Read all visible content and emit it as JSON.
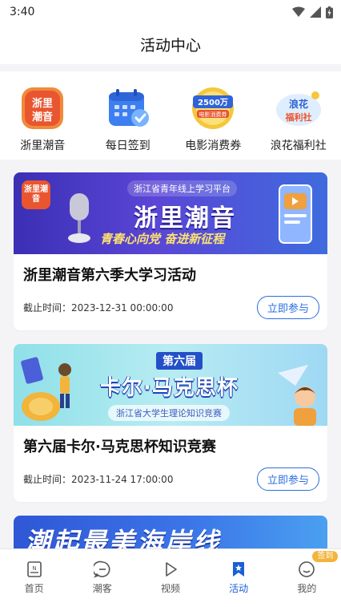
{
  "status": {
    "time": "3:40"
  },
  "header": {
    "title": "活动中心"
  },
  "quick_actions": [
    {
      "label": "浙里潮音",
      "icon": "zheli-chaoyin-logo-icon",
      "logo_text": "浙里潮音"
    },
    {
      "label": "每日签到",
      "icon": "calendar-check-icon"
    },
    {
      "label": "电影消费券",
      "icon": "movie-coupon-icon",
      "logo_text": "2500万 电影消费券"
    },
    {
      "label": "浪花福利社",
      "icon": "langhua-welfare-icon",
      "logo_text": "浪花福利社"
    }
  ],
  "activities": [
    {
      "title": "浙里潮音第六季大学习活动",
      "deadline": "截止时间：2023-12-31 00:00:00",
      "button": "立即参与",
      "banner": {
        "tag": "浙江省青年线上学习平台",
        "headline": "浙里潮音",
        "slogan": "青春心向党 奋进新征程",
        "logo": "浙里潮音"
      }
    },
    {
      "title": "第六届卡尔·马克思杯知识竞赛",
      "deadline": "截止时间：2023-11-24 17:00:00",
      "button": "立即参与",
      "banner": {
        "tag": "第六届",
        "headline": "卡尔·马克思杯",
        "slogan": "浙江省大学生理论知识竞赛"
      }
    }
  ],
  "partial_banner": {
    "headline": "潮起最美海岸线"
  },
  "tabs": [
    {
      "label": "首页",
      "icon": "news-icon",
      "active": false
    },
    {
      "label": "潮客",
      "icon": "chat-icon",
      "active": false
    },
    {
      "label": "视频",
      "icon": "play-icon",
      "active": false
    },
    {
      "label": "活动",
      "icon": "star-bookmark-icon",
      "active": true
    },
    {
      "label": "我的",
      "icon": "profile-icon",
      "active": false,
      "badge": "签到"
    }
  ],
  "colors": {
    "accent": "#1a5fd6",
    "button": "#2b6ee0",
    "badge": "#f2b43a"
  }
}
